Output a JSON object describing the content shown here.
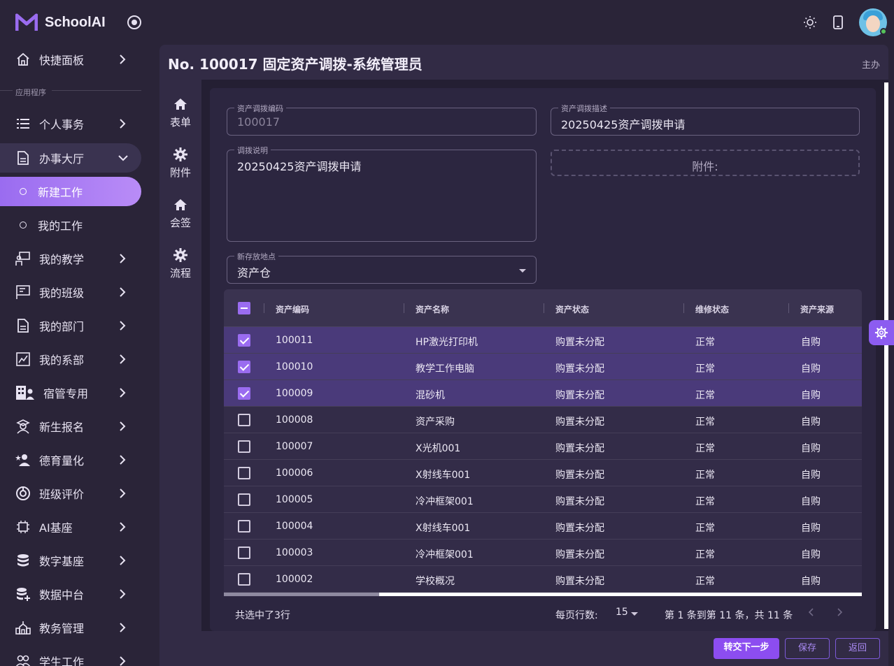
{
  "app": {
    "name": "SchoolAI"
  },
  "sidebar": {
    "section_label": "应用程序",
    "items": [
      {
        "label": "快捷面板",
        "icon": "home-icon"
      },
      {
        "label": "个人事务",
        "icon": "list-icon"
      },
      {
        "label": "办事大厅",
        "icon": "document-icon"
      },
      {
        "label": "新建工作",
        "icon": "circle-icon"
      },
      {
        "label": "我的工作",
        "icon": "circle-icon"
      },
      {
        "label": "我的教学",
        "icon": "teacher-icon"
      },
      {
        "label": "我的班级",
        "icon": "class-icon"
      },
      {
        "label": "我的部门",
        "icon": "document-icon"
      },
      {
        "label": "我的系部",
        "icon": "chart-icon"
      },
      {
        "label": "宿管专用",
        "icon": "building-icon"
      },
      {
        "label": "新生报名",
        "icon": "user-icon"
      },
      {
        "label": "德育量化",
        "icon": "user-star-icon"
      },
      {
        "label": "班级评价",
        "icon": "rating-icon"
      },
      {
        "label": "AI基座",
        "icon": "ai-chip-icon"
      },
      {
        "label": "数字基座",
        "icon": "database-icon"
      },
      {
        "label": "数据中台",
        "icon": "database-add-icon"
      },
      {
        "label": "教务管理",
        "icon": "school-icon"
      },
      {
        "label": "学生工作",
        "icon": "students-icon"
      }
    ]
  },
  "page": {
    "title": "No. 100017 固定资产调拨-系统管理员",
    "role": "主办"
  },
  "side_tabs": [
    {
      "label": "表单",
      "icon": "home-icon"
    },
    {
      "label": "附件",
      "icon": "gear-icon"
    },
    {
      "label": "会签",
      "icon": "home-icon"
    },
    {
      "label": "流程",
      "icon": "gear-icon"
    }
  ],
  "form": {
    "code": {
      "label": "资产调拨编码",
      "value": "100017"
    },
    "desc": {
      "label": "资产调拨描述",
      "value": "20250425资产调拨申请"
    },
    "note": {
      "label": "调拨说明",
      "value": "20250425资产调拨申请"
    },
    "attachment": {
      "label": "附件:"
    },
    "location": {
      "label": "新存放地点",
      "value": "资产仓"
    }
  },
  "table": {
    "headers": [
      "资产编码",
      "资产名称",
      "资产状态",
      "维修状态",
      "资产来源"
    ],
    "rows": [
      {
        "selected": true,
        "cells": [
          "100011",
          "HP激光打印机",
          "购置未分配",
          "正常",
          "自购"
        ]
      },
      {
        "selected": true,
        "cells": [
          "100010",
          "教学工作电脑",
          "购置未分配",
          "正常",
          "自购"
        ]
      },
      {
        "selected": true,
        "cells": [
          "100009",
          "混砂机",
          "购置未分配",
          "正常",
          "自购"
        ]
      },
      {
        "selected": false,
        "cells": [
          "100008",
          "资产采购",
          "购置未分配",
          "正常",
          "自购"
        ]
      },
      {
        "selected": false,
        "cells": [
          "100007",
          "X光机001",
          "购置未分配",
          "正常",
          "自购"
        ]
      },
      {
        "selected": false,
        "cells": [
          "100006",
          "X射线车001",
          "购置未分配",
          "正常",
          "自购"
        ]
      },
      {
        "selected": false,
        "cells": [
          "100005",
          "冷冲框架001",
          "购置未分配",
          "正常",
          "自购"
        ]
      },
      {
        "selected": false,
        "cells": [
          "100004",
          "X射线车001",
          "购置未分配",
          "正常",
          "自购"
        ]
      },
      {
        "selected": false,
        "cells": [
          "100003",
          "冷冲框架001",
          "购置未分配",
          "正常",
          "自购"
        ]
      },
      {
        "selected": false,
        "cells": [
          "100002",
          "学校概况",
          "购置未分配",
          "正常",
          "自购"
        ]
      }
    ],
    "footer": {
      "selected_text": "共选中了3行",
      "rows_per_page_label": "每页行数:",
      "rows_per_page": "15",
      "range_text": "第 1 条到第 11 条，共 11 条"
    }
  },
  "actions": {
    "submit": "转交下一步",
    "save": "保存",
    "back": "返回"
  },
  "colors": {
    "accent": "#9a6cf0",
    "background": "#2a2438",
    "selected_row": "#4a3a7a"
  }
}
